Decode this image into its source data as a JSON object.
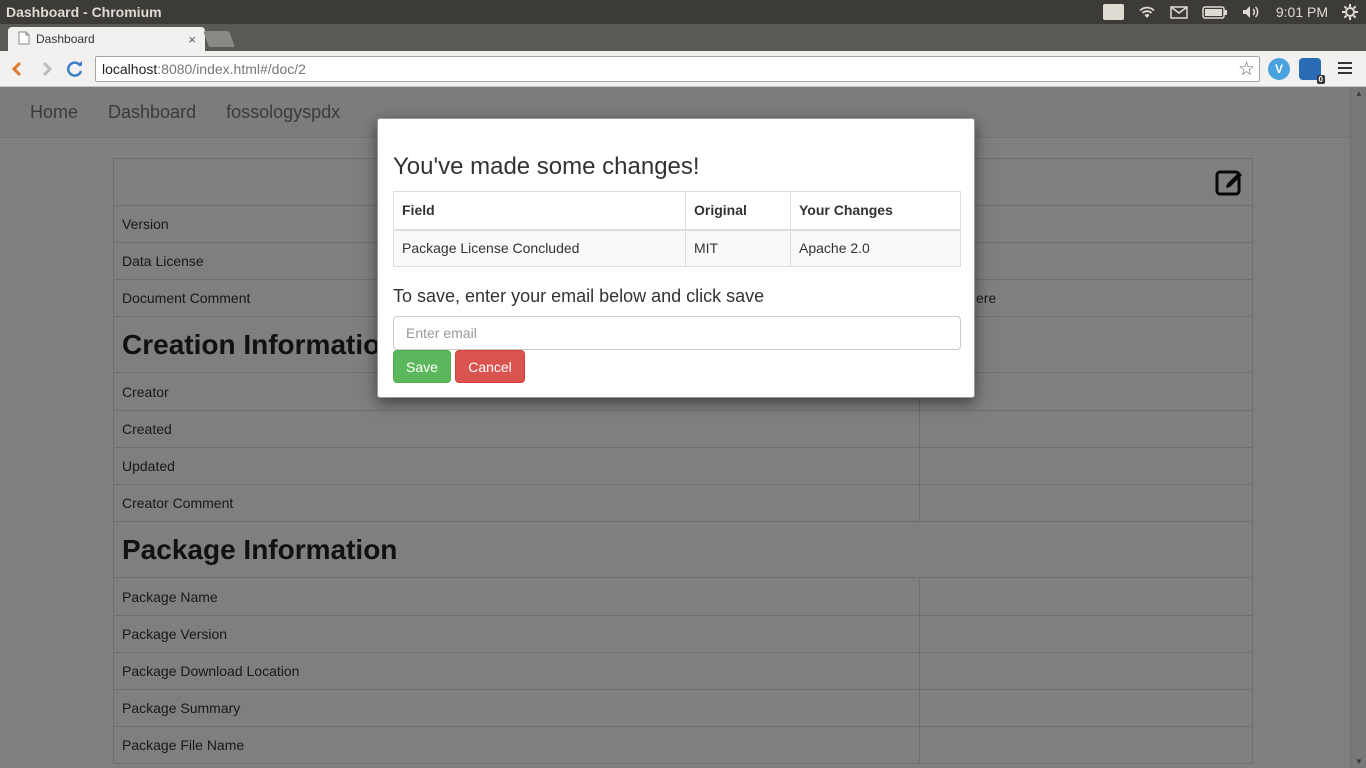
{
  "os": {
    "window_title": "Dashboard - Chromium",
    "keyboard_indicator": "En",
    "clock": "9:01 PM"
  },
  "browser": {
    "tab_title": "Dashboard",
    "tab_close": "×",
    "url_host": "localhost",
    "url_rest": ":8080/index.html#/doc/2",
    "extension_badge": "0"
  },
  "navbar": {
    "items": [
      "Home",
      "Dashboard",
      "fossologyspdx"
    ]
  },
  "doc": {
    "rows_top": [
      "Version",
      "Data License",
      "Document Comment"
    ],
    "comment_value_partial": "ere",
    "creation_heading": "Creation Information",
    "creation_rows": [
      "Creator",
      "Created",
      "Updated",
      "Creator Comment"
    ],
    "package_heading": "Package Information",
    "package_rows": [
      "Package Name",
      "Package Version",
      "Package Download Location",
      "Package Summary",
      "Package File Name"
    ]
  },
  "modal": {
    "title": "You've made some changes!",
    "columns": [
      "Field",
      "Original",
      "Your Changes"
    ],
    "changes": [
      {
        "field": "Package License Concluded",
        "original": "MIT",
        "changed": "Apache 2.0"
      }
    ],
    "prompt": "To save, enter your email below and click save",
    "email_placeholder": "Enter email",
    "save_label": "Save",
    "cancel_label": "Cancel"
  },
  "colors": {
    "save": "#5cb85c",
    "cancel": "#d9534f",
    "backdrop": "rgba(0,0,0,0.5)"
  }
}
